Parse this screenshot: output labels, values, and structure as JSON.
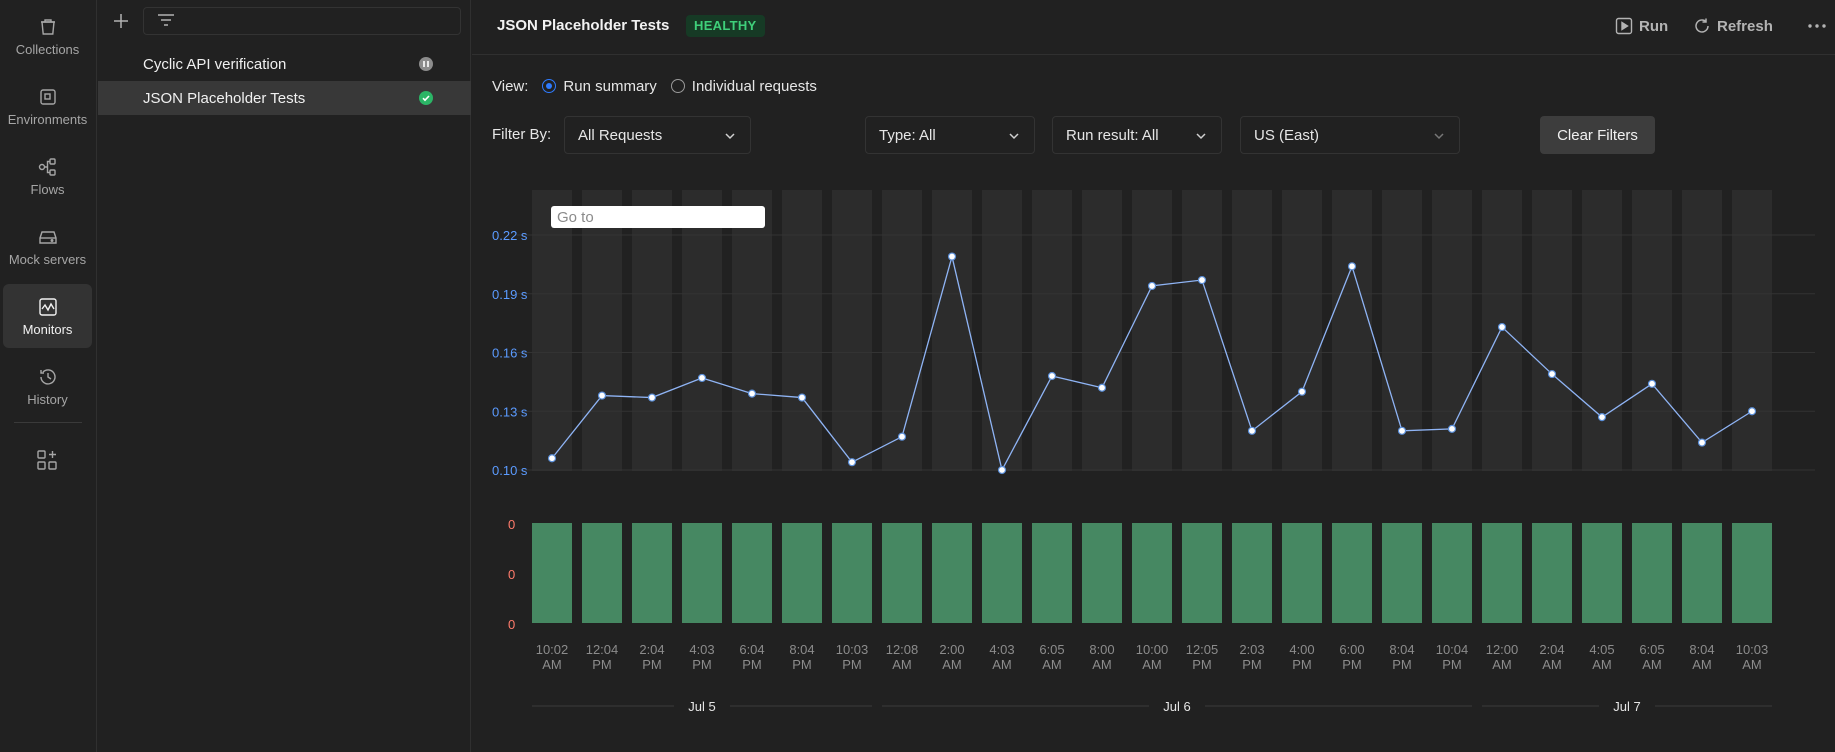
{
  "rail": {
    "items": [
      {
        "label": "Collections",
        "icon": "trash-can-icon"
      },
      {
        "label": "Environments",
        "icon": "environment-icon"
      },
      {
        "label": "Flows",
        "icon": "flows-icon"
      },
      {
        "label": "Mock servers",
        "icon": "mock-server-icon"
      },
      {
        "label": "Monitors",
        "icon": "monitor-icon",
        "active": true
      },
      {
        "label": "History",
        "icon": "history-icon"
      }
    ]
  },
  "sidebar": {
    "items": [
      {
        "label": "Cyclic API verification",
        "status": "paused"
      },
      {
        "label": "JSON Placeholder Tests",
        "status": "healthy",
        "active": true
      }
    ]
  },
  "header": {
    "title": "JSON Placeholder Tests",
    "badge": "HEALTHY",
    "run_label": "Run",
    "refresh_label": "Refresh"
  },
  "view": {
    "label": "View:",
    "options": [
      "Run summary",
      "Individual requests"
    ],
    "selected": "Run summary"
  },
  "filters": {
    "label": "Filter By:",
    "requests": "All Requests",
    "type": "Type: All",
    "run_result": "Run result: All",
    "region": "US (East)",
    "clear_label": "Clear Filters"
  },
  "goto": {
    "placeholder": "Go to"
  },
  "colors": {
    "accent": "#2e7bff",
    "line": "#8fb4f5",
    "bar": "#468862",
    "healthy": "#3fcf7a",
    "axis_blue": "#5b9bff",
    "axis_red": "#ff7b6b"
  },
  "chart_data": {
    "type": "line",
    "y_ticks": [
      "0.22 s",
      "0.19 s",
      "0.16 s",
      "0.13 s",
      "0.10 s"
    ],
    "ylim": [
      0.1,
      0.22
    ],
    "x": [
      "10:02 AM",
      "12:04 PM",
      "2:04 PM",
      "4:03 PM",
      "6:04 PM",
      "8:04 PM",
      "10:03 PM",
      "12:08 AM",
      "2:00 AM",
      "4:03 AM",
      "6:05 AM",
      "8:00 AM",
      "10:00 AM",
      "12:05 PM",
      "2:03 PM",
      "4:00 PM",
      "6:00 PM",
      "8:04 PM",
      "10:04 PM",
      "12:00 AM",
      "2:04 AM",
      "4:05 AM",
      "6:05 AM",
      "8:04 AM",
      "10:03 AM"
    ],
    "series": [
      {
        "values": [
          0.106,
          0.138,
          0.137,
          0.147,
          0.139,
          0.137,
          0.104,
          0.117,
          0.209,
          0.1,
          0.148,
          0.142,
          0.194,
          0.197,
          0.12,
          0.14,
          0.204,
          0.12,
          0.121,
          0.173,
          0.149,
          0.127,
          0.144,
          0.114,
          0.13
        ]
      }
    ],
    "bars": {
      "y_ticks": [
        "0",
        "0",
        "0"
      ],
      "values": [
        1,
        1,
        1,
        1,
        1,
        1,
        1,
        1,
        1,
        1,
        1,
        1,
        1,
        1,
        1,
        1,
        1,
        1,
        1,
        1,
        1,
        1,
        1,
        1,
        1
      ]
    },
    "date_groups": [
      {
        "label": "Jul 5",
        "from": 0,
        "to": 6
      },
      {
        "label": "Jul 6",
        "from": 7,
        "to": 18
      },
      {
        "label": "Jul 7",
        "from": 19,
        "to": 24
      }
    ]
  }
}
